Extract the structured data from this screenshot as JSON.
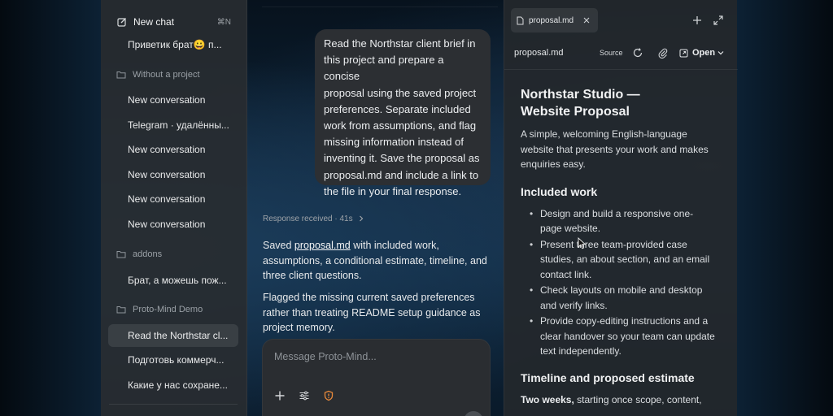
{
  "sidebar": {
    "new_chat": {
      "label": "New chat",
      "shortcut": "⌘N"
    },
    "top_items": [
      {
        "label": "Приветик брат😀 п..."
      }
    ],
    "groups": [
      {
        "label": "Without a project",
        "items": [
          {
            "label": "New conversation"
          },
          {
            "label": "Telegram · удалённы..."
          },
          {
            "label": "New conversation"
          },
          {
            "label": "New conversation"
          },
          {
            "label": "New conversation"
          },
          {
            "label": "New conversation"
          }
        ]
      },
      {
        "label": "addons",
        "items": [
          {
            "label": "Брат, а можешь пож..."
          }
        ]
      },
      {
        "label": "Proto-Mind Demo",
        "items": [
          {
            "label": "Read the Northstar cl...",
            "active": true
          },
          {
            "label": "Подготовь коммерч..."
          },
          {
            "label": "Какие у нас сохране..."
          }
        ]
      }
    ]
  },
  "chat": {
    "user_message_lines": [
      "Read the Northstar client brief in",
      "this project and prepare a concise",
      "proposal using the saved project",
      "preferences. Separate included",
      "work from assumptions, and flag",
      "missing information instead of",
      "inventing it. Save the proposal as",
      "proposal.md and include a link to",
      "the file in your final response."
    ],
    "response_meta": "Response received · 41s",
    "reply": {
      "p1_before": "Saved ",
      "p1_link": "proposal.md",
      "p1_line1_after": " with included work,",
      "p1_lines": [
        "assumptions, a conditional estimate, timeline, and",
        "three client questions."
      ],
      "p2_lines": [
        "Flagged the missing current saved preferences",
        "rather than treating README setup guidance as",
        "project memory."
      ]
    },
    "composer_placeholder": "Message Proto-Mind..."
  },
  "panel": {
    "tab_label": "proposal.md",
    "filename": "proposal.md",
    "source_label": "Source",
    "open_label": "Open",
    "doc": {
      "title_lines": [
        "Northstar Studio —",
        "Website Proposal"
      ],
      "intro_lines": [
        "A simple, welcoming English-language",
        "website that presents your work and makes",
        "enquiries easy."
      ],
      "included_heading": "Included work",
      "included_items": [
        [
          "Design and build a responsive one-",
          "page website."
        ],
        [
          "Present three team-provided case",
          "studies, an about section, and an email",
          "contact link."
        ],
        [
          "Check layouts on mobile and desktop",
          "and verify links."
        ],
        [
          "Provide copy-editing instructions and a",
          "clear handover so your team can update",
          "text independently."
        ]
      ],
      "timeline_heading": "Timeline and proposed estimate",
      "timeline_bold": "Two weeks,",
      "timeline_rest": " starting once scope, content,"
    }
  },
  "icons": {
    "new_chat": "pencil-square-icon",
    "group": "folder-icon",
    "add": "plus-icon",
    "expand": "expand-icon",
    "refresh": "refresh-icon",
    "attach": "paperclip-icon",
    "open": "external-link-icon",
    "close": "close-icon",
    "file": "file-icon"
  },
  "colors": {
    "accent_orange": "#e8893a",
    "sidebar_bg": "#282c30",
    "bubble_bg": "#2c2f33"
  }
}
